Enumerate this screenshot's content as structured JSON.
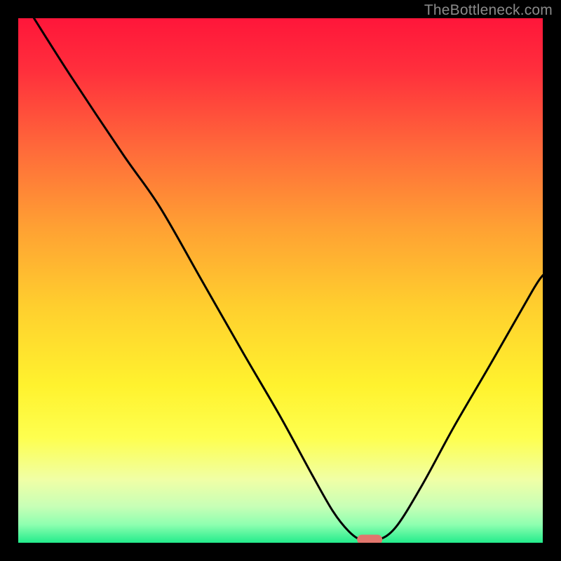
{
  "watermark": {
    "text": "TheBottleneck.com"
  },
  "colors": {
    "frame": "#000000",
    "curve": "#000000",
    "marker_fill": "#e2766d",
    "gradient_stops": [
      {
        "offset": 0.0,
        "color": "#ff163a"
      },
      {
        "offset": 0.1,
        "color": "#ff2f3c"
      },
      {
        "offset": 0.25,
        "color": "#ff6a3a"
      },
      {
        "offset": 0.4,
        "color": "#ffa133"
      },
      {
        "offset": 0.55,
        "color": "#ffcf2e"
      },
      {
        "offset": 0.7,
        "color": "#fff22e"
      },
      {
        "offset": 0.8,
        "color": "#feff4f"
      },
      {
        "offset": 0.88,
        "color": "#f0ffa6"
      },
      {
        "offset": 0.93,
        "color": "#c8ffb6"
      },
      {
        "offset": 0.965,
        "color": "#8fffb0"
      },
      {
        "offset": 1.0,
        "color": "#23ec8c"
      }
    ]
  },
  "chart_data": {
    "type": "line",
    "title": "",
    "xlabel": "",
    "ylabel": "",
    "xlim": [
      0,
      100
    ],
    "ylim": [
      0,
      100
    ],
    "grid": false,
    "legend": false,
    "series": [
      {
        "name": "bottleneck-curve",
        "x": [
          3,
          10,
          20,
          27,
          35,
          43,
          50,
          56,
          60,
          63,
          65.5,
          68.5,
          72,
          77,
          83,
          90,
          98,
          100
        ],
        "y": [
          100,
          89,
          74,
          64,
          50,
          36,
          24,
          13,
          6,
          2.2,
          0.5,
          0.5,
          3,
          11,
          22,
          34,
          48,
          51
        ]
      }
    ],
    "annotations": [
      {
        "name": "optimal-marker",
        "x": 67,
        "y": 0.6,
        "shape": "pill"
      }
    ]
  }
}
